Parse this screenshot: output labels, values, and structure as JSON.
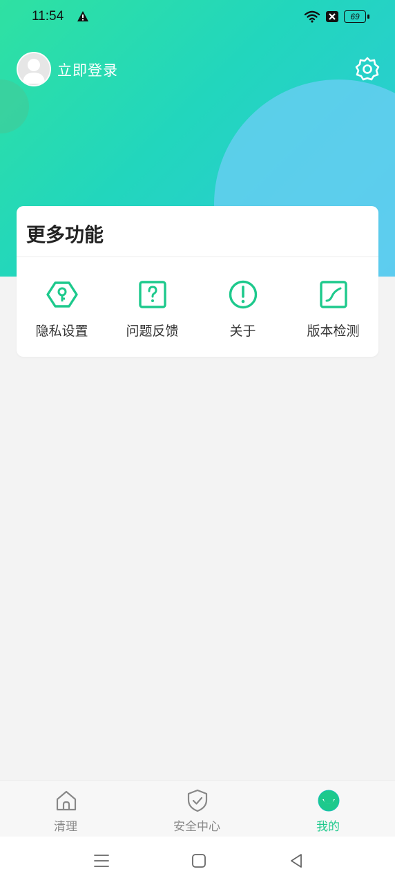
{
  "status_bar": {
    "time": "11:54",
    "battery": "69",
    "icons": [
      "warning-icon",
      "wifi-icon",
      "sim-icon",
      "battery-icon"
    ]
  },
  "header": {
    "login_label": "立即登录",
    "settings_icon": "gear-icon"
  },
  "card": {
    "title": "更多功能",
    "items": [
      {
        "label": "隐私设置",
        "icon": "key-hexagon-icon"
      },
      {
        "label": "问题反馈",
        "icon": "question-box-icon"
      },
      {
        "label": "关于",
        "icon": "info-circle-icon"
      },
      {
        "label": "版本检测",
        "icon": "trend-line-icon"
      }
    ]
  },
  "tabs": [
    {
      "label": "清理",
      "icon": "home-icon",
      "active": false
    },
    {
      "label": "安全中心",
      "icon": "shield-check-icon",
      "active": false
    },
    {
      "label": "我的",
      "icon": "smile-face-icon",
      "active": true
    }
  ],
  "nav": [
    "menu-icon",
    "home-square-icon",
    "back-triangle-icon"
  ],
  "colors": {
    "accent": "#1dc98c",
    "hero_start": "#2fe1a2",
    "hero_end": "#2ec8dc",
    "tab_inactive": "#888888"
  }
}
